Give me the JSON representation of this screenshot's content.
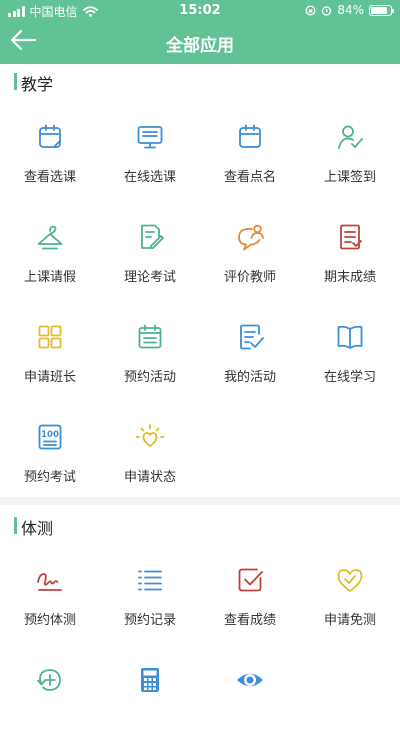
{
  "status_bar": {
    "carrier": "中国电信",
    "time": "15:02",
    "battery": "84%"
  },
  "header": {
    "title": "全部应用"
  },
  "sections": [
    {
      "title": "教学"
    },
    {
      "title": "体测"
    }
  ],
  "teaching_apps": [
    {
      "label": "查看选课",
      "icon": "calendar-note-icon",
      "color": "#3d8fd4"
    },
    {
      "label": "在线选课",
      "icon": "monitor-icon",
      "color": "#3d8fd4"
    },
    {
      "label": "查看点名",
      "icon": "calendar-icon",
      "color": "#3d8fd4"
    },
    {
      "label": "上课签到",
      "icon": "user-check-icon",
      "color": "#4fb38a"
    },
    {
      "label": "上课请假",
      "icon": "hanger-icon",
      "color": "#4fb38a"
    },
    {
      "label": "理论考试",
      "icon": "document-pen-icon",
      "color": "#4fb38a"
    },
    {
      "label": "评价教师",
      "icon": "speech-person-icon",
      "color": "#e08b3a"
    },
    {
      "label": "期末成绩",
      "icon": "report-icon",
      "color": "#c0413b"
    },
    {
      "label": "申请班长",
      "icon": "grid-icon",
      "color": "#e3bb2e"
    },
    {
      "label": "预约活动",
      "icon": "calendar-list-icon",
      "color": "#4fb38a"
    },
    {
      "label": "我的活动",
      "icon": "checklist-icon",
      "color": "#3d8fd4"
    },
    {
      "label": "在线学习",
      "icon": "book-icon",
      "color": "#3d8fd4"
    },
    {
      "label": "预约考试",
      "icon": "score-100-icon",
      "color": "#3d8fd4"
    },
    {
      "label": "申请状态",
      "icon": "sun-heart-icon",
      "color": "#e3bb2e"
    }
  ],
  "fitness_apps": [
    {
      "label": "预约体测",
      "icon": "signature-icon",
      "color": "#c0413b"
    },
    {
      "label": "预约记录",
      "icon": "list-icon",
      "color": "#3d8fd4"
    },
    {
      "label": "查看成绩",
      "icon": "check-square-icon",
      "color": "#c0413b"
    },
    {
      "label": "申请免测",
      "icon": "heart-check-icon",
      "color": "#e3bb2e"
    },
    {
      "label": "",
      "icon": "refresh-plus-icon",
      "color": "#4fb38a"
    },
    {
      "label": "",
      "icon": "calculator-icon",
      "color": "#3d8fd4"
    },
    {
      "label": "",
      "icon": "eye-icon",
      "color": "#3d8fd4"
    }
  ]
}
